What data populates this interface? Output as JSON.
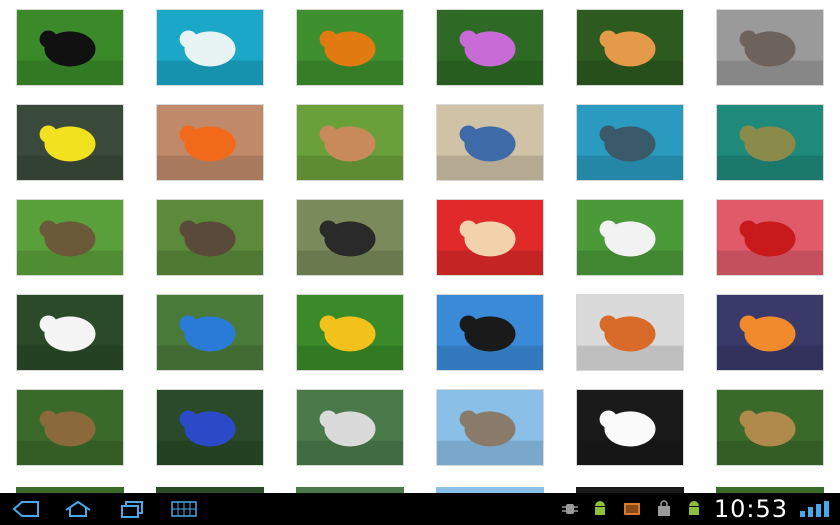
{
  "status_bar": {
    "time": "10:53"
  },
  "gallery": {
    "rows": [
      [
        {
          "name": "bear-photo",
          "bg": "#3a8a2a",
          "fg": "#111111"
        },
        {
          "name": "polar-bear-photo",
          "bg": "#1aa7c8",
          "fg": "#e8f4f4"
        },
        {
          "name": "butterfly-caterpillar-photo",
          "bg": "#3e8f2e",
          "fg": "#e27a12"
        },
        {
          "name": "butterfly-flowers-photo",
          "bg": "#2e6a25",
          "fg": "#c86bd6"
        },
        {
          "name": "orange-butterfly-photo",
          "bg": "#2d5a1f",
          "fg": "#e59a4a"
        },
        {
          "name": "cat-sleeping-photo",
          "bg": "#9a9a9a",
          "fg": "#6e625c"
        }
      ],
      [
        {
          "name": "yellow-fish-photo",
          "bg": "#3a4a3a",
          "fg": "#f2e11e"
        },
        {
          "name": "clownfish-photo",
          "bg": "#c08a6a",
          "fg": "#f06a1a"
        },
        {
          "name": "cows-photo",
          "bg": "#6aa03a",
          "fg": "#c98a5a"
        },
        {
          "name": "crab-sand-photo",
          "bg": "#cfc2a6",
          "fg": "#3e6aa8"
        },
        {
          "name": "dolphin-pool-photo",
          "bg": "#2a9ac0",
          "fg": "#3a5a6a"
        },
        {
          "name": "duck-water-photo",
          "bg": "#1f8a7a",
          "fg": "#8a8a4a"
        }
      ],
      [
        {
          "name": "ducklings-grass-photo",
          "bg": "#5aa03a",
          "fg": "#6a5a3a"
        },
        {
          "name": "duck-family-photo",
          "bg": "#5a8a3a",
          "fg": "#5a4a3a"
        },
        {
          "name": "spider-photo",
          "bg": "#7a8a5a",
          "fg": "#2a2a2a"
        },
        {
          "name": "hamster-photo",
          "bg": "#e02a2a",
          "fg": "#f2d2aa"
        },
        {
          "name": "pony-photo",
          "bg": "#4a9a3a",
          "fg": "#f2f2f2"
        },
        {
          "name": "ladybug-leaf-photo",
          "bg": "#e05a6a",
          "fg": "#c81a1a"
        }
      ],
      [
        {
          "name": "white-dog-photo",
          "bg": "#2a4a2a",
          "fg": "#f4f4f4"
        },
        {
          "name": "parrot-photo",
          "bg": "#4a7a3a",
          "fg": "#2a7ad8"
        },
        {
          "name": "yellow-flowers-bird-photo",
          "bg": "#3a8a2a",
          "fg": "#f2c21a"
        },
        {
          "name": "penguins-photo",
          "bg": "#3a8ad8",
          "fg": "#1a1a1a"
        },
        {
          "name": "robin-snow-photo",
          "bg": "#dadada",
          "fg": "#d86a2a"
        },
        {
          "name": "starfish-photo",
          "bg": "#3a3a6a",
          "fg": "#f08a2a"
        }
      ],
      [
        {
          "name": "yorkie-dog-photo",
          "bg": "#3a6a2a",
          "fg": "#8a6a3a"
        },
        {
          "name": "peacock-photo",
          "bg": "#2a4a2a",
          "fg": "#2a4ac8"
        },
        {
          "name": "cockatoo-photo",
          "bg": "#4a7a4a",
          "fg": "#dadada"
        },
        {
          "name": "kitten-blanket-photo",
          "bg": "#8ac0e8",
          "fg": "#8a7a6a"
        },
        {
          "name": "swan-photo",
          "bg": "#1a1a1a",
          "fg": "#fafafa"
        },
        {
          "name": "lion-photo",
          "bg": "#3a6a2a",
          "fg": "#b08a4a"
        }
      ]
    ]
  },
  "navbar": {
    "back_icon": "back-icon",
    "home_icon": "home-icon",
    "recent_icon": "recent-apps-icon",
    "apps_icon": "all-apps-icon"
  },
  "colors": {
    "navbar_bg": "#000000",
    "icon_blue": "#4aa8e8",
    "clock_color": "#ffffff"
  }
}
